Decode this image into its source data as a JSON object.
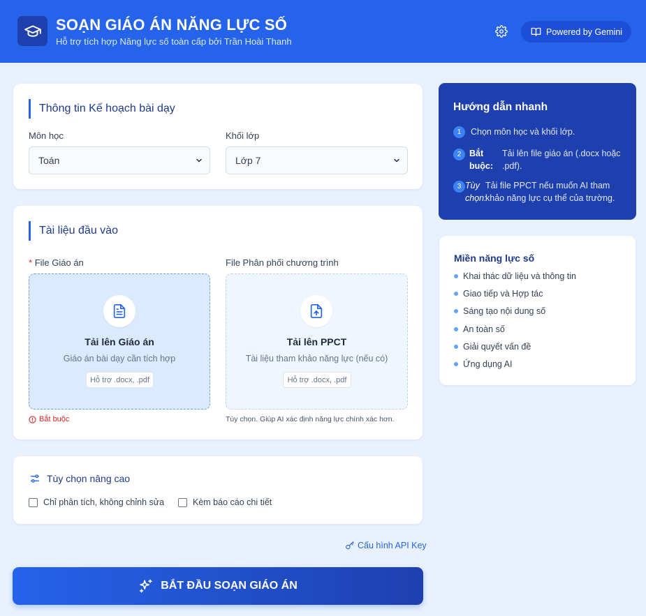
{
  "header": {
    "title": "SOẠN GIÁO ÁN NĂNG LỰC SỐ",
    "subtitle": "Hỗ trợ tích hợp Năng lực số toàn cấp bởi Trần Hoài Thanh",
    "powered_label": "Powered by Gemini"
  },
  "lesson_info": {
    "title": "Thông tin Kế hoạch bài dạy",
    "subject_label": "Môn học",
    "subject_value": "Toán",
    "grade_label": "Khối lớp",
    "grade_value": "Lớp 7"
  },
  "inputs": {
    "title": "Tài liệu đầu vào",
    "lesson_file": {
      "required_mark": "*",
      "label": "File Giáo án",
      "title": "Tải lên Giáo án",
      "subtitle": "Giáo án bài dạy cần tích hợp",
      "badge": "Hỗ trợ .docx, .pdf",
      "note": "Bắt buộc"
    },
    "ppct_file": {
      "label": "File Phân phối chương trình",
      "title": "Tải lên PPCT",
      "subtitle": "Tài liệu tham khảo năng lực (nếu có)",
      "badge": "Hỗ trợ .docx, .pdf",
      "note": "Tùy chọn. Giúp AI xác định năng lực chính xác hơn."
    }
  },
  "advanced": {
    "title": "Tùy chọn nâng cao",
    "option_analyze_only": "Chỉ phân tích, không chỉnh sửa",
    "option_report": "Kèm báo cáo chi tiết"
  },
  "api_key_link": "Cấu hình API Key",
  "start_button": "BẮT ĐẦU SOẠN GIÁO ÁN",
  "guide": {
    "title": "Hướng dẫn nhanh",
    "steps": [
      {
        "num": "1",
        "prefix": "",
        "text": "Chọn môn học và khối lớp."
      },
      {
        "num": "2",
        "prefix": "Bắt buộc:",
        "text": "Tải lên file giáo án (.docx hoặc .pdf)."
      },
      {
        "num": "3",
        "prefix": "Tùy chọn:",
        "text": "Tải file PPCT nếu muốn AI tham khảo năng lực cụ thể của trường."
      }
    ]
  },
  "domains": {
    "title": "Miền năng lực số",
    "items": [
      "Khai thác dữ liệu và thông tin",
      "Giao tiếp và Hợp tác",
      "Sáng tạo nội dung số",
      "An toàn số",
      "Giải quyết vấn đề",
      "Ứng dụng AI"
    ]
  },
  "colors": {
    "primary": "#2563eb",
    "primary_dark": "#1e40af",
    "background": "#e8f1fd",
    "required": "#dc2626"
  }
}
